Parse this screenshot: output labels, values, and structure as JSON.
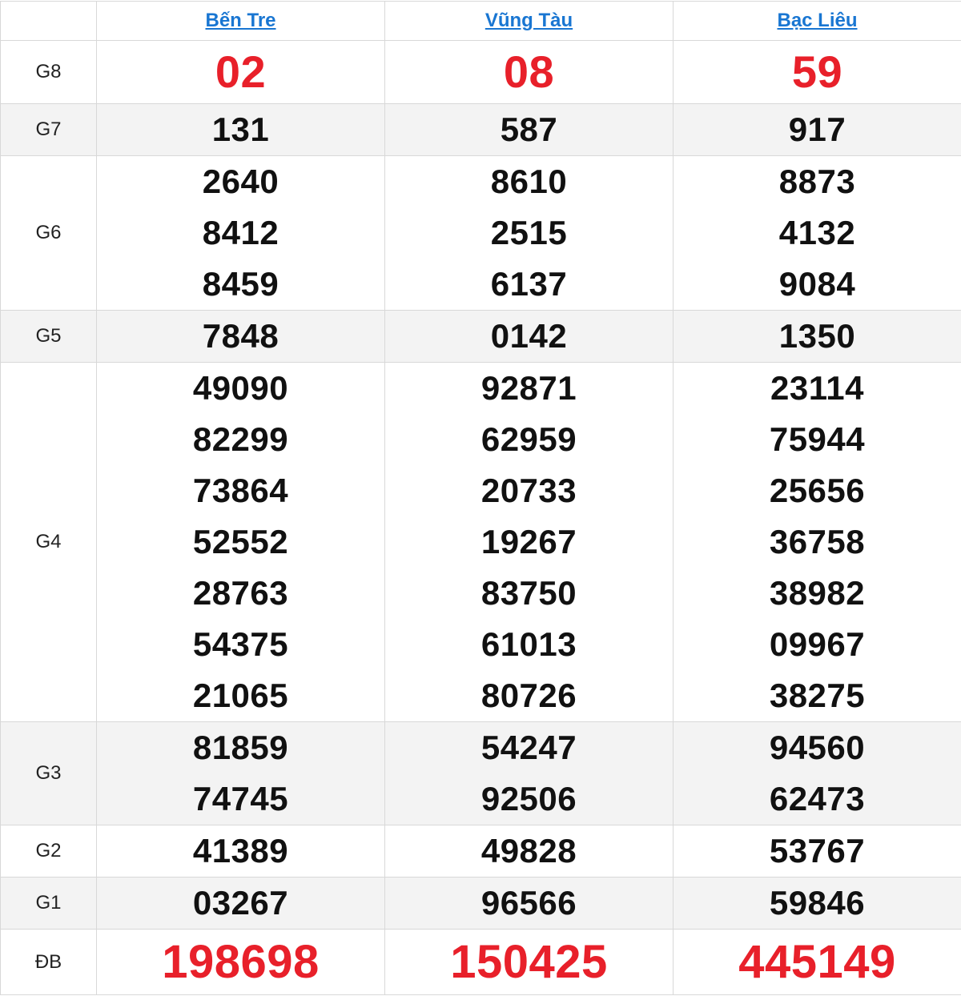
{
  "provinces": [
    "Bến Tre",
    "Vũng Tàu",
    "Bạc Liêu"
  ],
  "prizes": {
    "g8": {
      "label": "G8",
      "results": [
        [
          "02"
        ],
        [
          "08"
        ],
        [
          "59"
        ]
      ]
    },
    "g7": {
      "label": "G7",
      "results": [
        [
          "131"
        ],
        [
          "587"
        ],
        [
          "917"
        ]
      ]
    },
    "g6": {
      "label": "G6",
      "results": [
        [
          "2640",
          "8412",
          "8459"
        ],
        [
          "8610",
          "2515",
          "6137"
        ],
        [
          "8873",
          "4132",
          "9084"
        ]
      ]
    },
    "g5": {
      "label": "G5",
      "results": [
        [
          "7848"
        ],
        [
          "0142"
        ],
        [
          "1350"
        ]
      ]
    },
    "g4": {
      "label": "G4",
      "results": [
        [
          "49090",
          "82299",
          "73864",
          "52552",
          "28763",
          "54375",
          "21065"
        ],
        [
          "92871",
          "62959",
          "20733",
          "19267",
          "83750",
          "61013",
          "80726"
        ],
        [
          "23114",
          "75944",
          "25656",
          "36758",
          "38982",
          "09967",
          "38275"
        ]
      ]
    },
    "g3": {
      "label": "G3",
      "results": [
        [
          "81859",
          "74745"
        ],
        [
          "54247",
          "92506"
        ],
        [
          "94560",
          "62473"
        ]
      ]
    },
    "g2": {
      "label": "G2",
      "results": [
        [
          "41389"
        ],
        [
          "49828"
        ],
        [
          "53767"
        ]
      ]
    },
    "g1": {
      "label": "G1",
      "results": [
        [
          "03267"
        ],
        [
          "96566"
        ],
        [
          "59846"
        ]
      ]
    },
    "db": {
      "label": "ĐB",
      "results": [
        [
          "198698"
        ],
        [
          "150425"
        ],
        [
          "445149"
        ]
      ]
    }
  },
  "colors": {
    "header_link": "#1976d2",
    "highlight_red": "#e8202a",
    "shaded_row": "#f3f3f3",
    "border": "#d8d8d8"
  }
}
